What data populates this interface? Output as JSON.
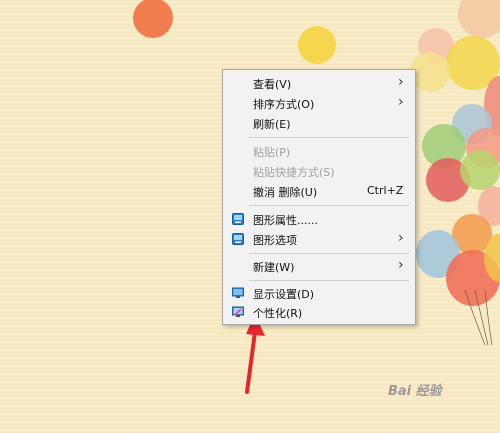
{
  "context_menu": {
    "items": {
      "view": {
        "label": "查看(V)"
      },
      "sort": {
        "label": "排序方式(O)"
      },
      "refresh": {
        "label": "刷新(E)"
      },
      "paste": {
        "label": "粘贴(P)"
      },
      "paste_shortcut": {
        "label": "粘贴快捷方式(S)"
      },
      "undo_delete": {
        "label": "撤消 删除(U)",
        "shortcut": "Ctrl+Z"
      },
      "graphics_properties": {
        "label": "图形属性......"
      },
      "graphics_options": {
        "label": "图形选项"
      },
      "new": {
        "label": "新建(W)"
      },
      "display_settings": {
        "label": "显示设置(D)"
      },
      "personalize": {
        "label": "个性化(R)"
      }
    }
  },
  "icons": {
    "submenu_arrow": "chevron-right-icon",
    "graphics": "intel-graphics-icon",
    "display": "monitor-icon",
    "personalize": "personalize-icon"
  },
  "watermark": {
    "text": "Bai 经验"
  },
  "colors": {
    "annotation_arrow": "#e8262a",
    "desktop_bg": "#f8ecc8",
    "menu_bg": "#f2f2f2"
  }
}
